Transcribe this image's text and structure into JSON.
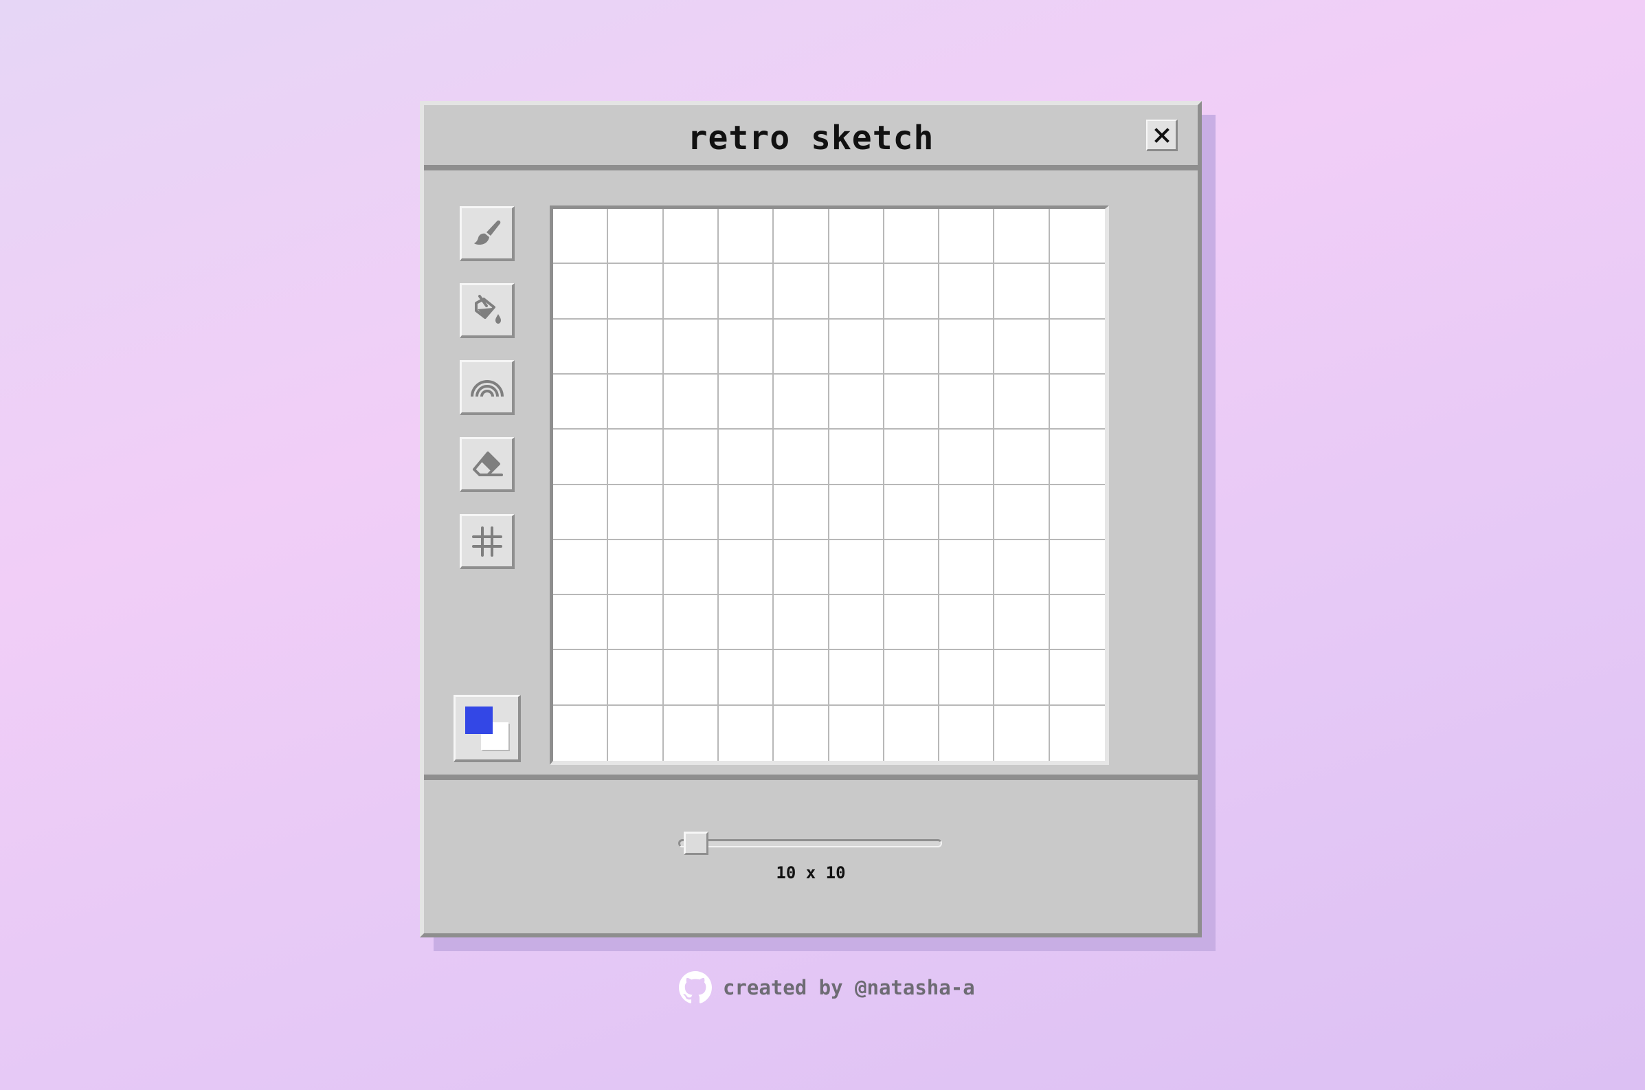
{
  "app": {
    "title": "retro sketch",
    "close_icon": "close-icon"
  },
  "toolbar": {
    "tools": [
      {
        "name": "brush",
        "icon": "brush-icon"
      },
      {
        "name": "fill",
        "icon": "paint-bucket-icon"
      },
      {
        "name": "rainbow",
        "icon": "rainbow-icon"
      },
      {
        "name": "eraser",
        "icon": "eraser-icon"
      },
      {
        "name": "grid",
        "icon": "grid-icon"
      }
    ],
    "primary_color": "#3347e6",
    "secondary_color": "#ffffff"
  },
  "canvas": {
    "rows": 10,
    "columns": 10,
    "cell_color": "#ffffff",
    "line_color": "#b8b8b8"
  },
  "size_control": {
    "value": 10,
    "label": "10 x 10"
  },
  "footer": {
    "credit_text": "created by @natasha-a",
    "icon": "github-icon"
  }
}
